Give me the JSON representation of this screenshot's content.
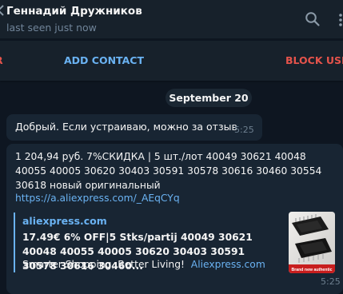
{
  "header": {
    "name": "Геннадий Дружников",
    "status": "last seen just now"
  },
  "action_bar": {
    "left_partial": "R",
    "add_contact": "ADD CONTACT",
    "block_user": "BLOCK USER"
  },
  "date_pill": "September 20",
  "messages": [
    {
      "text": "Добрый. Если устраиваю, можно за отзыв",
      "time": "5:25"
    },
    {
      "text": "1 204,94 руб.  7%СКИДКА | 5 шт./лот 40049 30621 40048 40055 40005 30620 30403 30591 30578 30616 30460 30554 30618 новый оригинальный",
      "link": "https://a.aliexpress.com/_AEqCYq",
      "time": "5:25",
      "preview": {
        "site": "aliexpress.com",
        "title": "17.49€ 6% OFF|5 Stks/partij 40049 30621 40048 40055 40005 30620 30403 30591 30578 30616 30460...",
        "description": "Smarter Shopping, Better Living!",
        "domain": "Aliexpress.com",
        "thumb_banner": "Brand new authentic"
      }
    }
  ],
  "colors": {
    "background": "#0e1621",
    "header": "#17212b",
    "bubble": "#182533",
    "accent": "#6ab2f2",
    "danger": "#e5534b",
    "secondary_text": "#708499"
  },
  "icons": [
    "back-chevron-icon",
    "search-icon",
    "more-options-icon"
  ]
}
